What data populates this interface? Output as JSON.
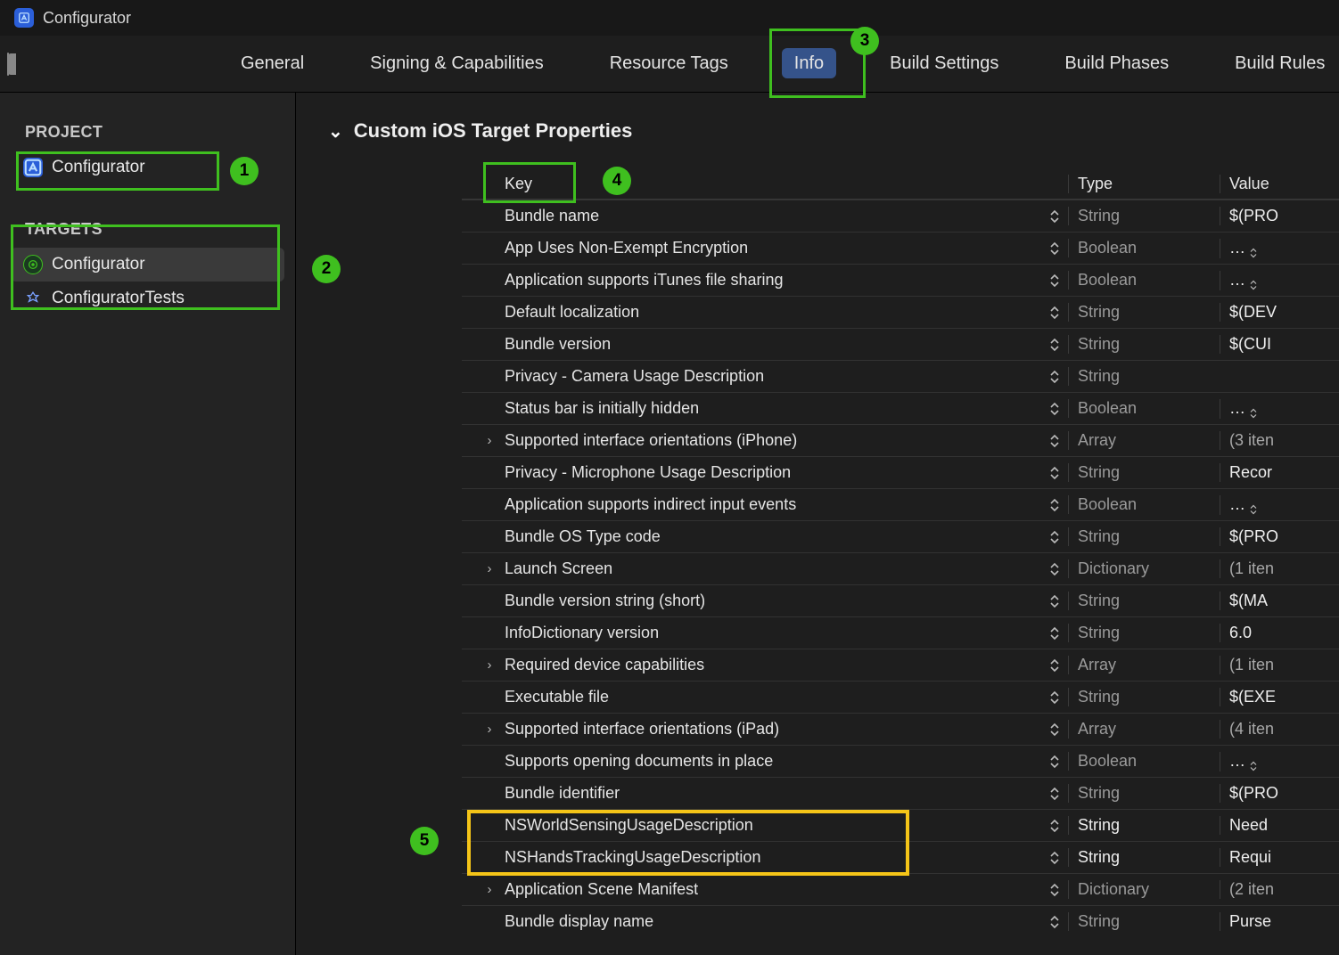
{
  "title": "Configurator",
  "tabs": [
    "General",
    "Signing & Capabilities",
    "Resource Tags",
    "Info",
    "Build Settings",
    "Build Phases",
    "Build Rules"
  ],
  "active_tab": "Info",
  "sidebar": {
    "project_heading": "PROJECT",
    "project_item": "Configurator",
    "targets_heading": "TARGETS",
    "targets": [
      "Configurator",
      "ConfiguratorTests"
    ],
    "selected_target": "Configurator"
  },
  "section_title": "Custom iOS Target Properties",
  "columns": {
    "key": "Key",
    "type": "Type",
    "value": "Value"
  },
  "callouts": {
    "c1": "1",
    "c2": "2",
    "c3": "3",
    "c4": "4",
    "c5": "5"
  },
  "rows": [
    {
      "key": "Bundle name",
      "type": "String",
      "value": "$(PRO",
      "expand": false,
      "type_strong": false
    },
    {
      "key": "App Uses Non-Exempt Encryption",
      "type": "Boolean",
      "value": "…",
      "expand": false,
      "type_strong": false,
      "valstepper": true
    },
    {
      "key": "Application supports iTunes file sharing",
      "type": "Boolean",
      "value": "…",
      "expand": false,
      "type_strong": false,
      "valstepper": true
    },
    {
      "key": "Default localization",
      "type": "String",
      "value": "$(DEV",
      "expand": false,
      "type_strong": false
    },
    {
      "key": "Bundle version",
      "type": "String",
      "value": "$(CUI",
      "expand": false,
      "type_strong": false
    },
    {
      "key": "Privacy - Camera Usage Description",
      "type": "String",
      "value": "",
      "expand": false,
      "type_strong": false
    },
    {
      "key": "Status bar is initially hidden",
      "type": "Boolean",
      "value": "…",
      "expand": false,
      "type_strong": false,
      "valstepper": true
    },
    {
      "key": "Supported interface orientations (iPhone)",
      "type": "Array",
      "value": "(3 iten",
      "expand": true,
      "type_strong": false,
      "value_muted": true
    },
    {
      "key": "Privacy - Microphone Usage Description",
      "type": "String",
      "value": "Recor",
      "expand": false,
      "type_strong": false
    },
    {
      "key": "Application supports indirect input events",
      "type": "Boolean",
      "value": "…",
      "expand": false,
      "type_strong": false,
      "valstepper": true
    },
    {
      "key": "Bundle OS Type code",
      "type": "String",
      "value": "$(PRO",
      "expand": false,
      "type_strong": false
    },
    {
      "key": "Launch Screen",
      "type": "Dictionary",
      "value": "(1 iten",
      "expand": true,
      "type_strong": false,
      "value_muted": true
    },
    {
      "key": "Bundle version string (short)",
      "type": "String",
      "value": "$(MA",
      "expand": false,
      "type_strong": false
    },
    {
      "key": "InfoDictionary version",
      "type": "String",
      "value": "6.0",
      "expand": false,
      "type_strong": false
    },
    {
      "key": "Required device capabilities",
      "type": "Array",
      "value": "(1 iten",
      "expand": true,
      "type_strong": false,
      "value_muted": true
    },
    {
      "key": "Executable file",
      "type": "String",
      "value": "$(EXE",
      "expand": false,
      "type_strong": false
    },
    {
      "key": "Supported interface orientations (iPad)",
      "type": "Array",
      "value": "(4 iten",
      "expand": true,
      "type_strong": false,
      "value_muted": true
    },
    {
      "key": "Supports opening documents in place",
      "type": "Boolean",
      "value": "…",
      "expand": false,
      "type_strong": false,
      "valstepper": true
    },
    {
      "key": "Bundle identifier",
      "type": "String",
      "value": "$(PRO",
      "expand": false,
      "type_strong": false
    },
    {
      "key": "NSWorldSensingUsageDescription",
      "type": "String",
      "value": "Need",
      "expand": false,
      "type_strong": true
    },
    {
      "key": "NSHandsTrackingUsageDescription",
      "type": "String",
      "value": "Requi",
      "expand": false,
      "type_strong": true
    },
    {
      "key": "Application Scene Manifest",
      "type": "Dictionary",
      "value": "(2 iten",
      "expand": true,
      "type_strong": false,
      "value_muted": true
    },
    {
      "key": "Bundle display name",
      "type": "String",
      "value": "Purse",
      "expand": false,
      "type_strong": false
    }
  ]
}
